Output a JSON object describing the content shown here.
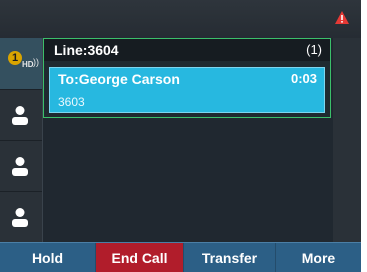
{
  "line": {
    "label": "Line:3604",
    "count": "(1)"
  },
  "call": {
    "callee": "To:George Carson",
    "duration": "0:03",
    "number": "3603"
  },
  "hd": {
    "badge": "1",
    "text": "HD",
    "waves": "))"
  },
  "softkeys": [
    {
      "label": "Hold"
    },
    {
      "label": "End Call"
    },
    {
      "label": "Transfer"
    },
    {
      "label": "More"
    }
  ],
  "icons": {
    "alert": "warning-triangle-icon",
    "person": "person-icon",
    "hd": "hd-voice-icon"
  },
  "colors": {
    "screen_bg": "#202830",
    "active_call": "#27b8e0",
    "line_border": "#3bbf6a",
    "softkey_bar": "#2c5f86",
    "end_call": "#b11d2b",
    "alert": "#e53935"
  }
}
